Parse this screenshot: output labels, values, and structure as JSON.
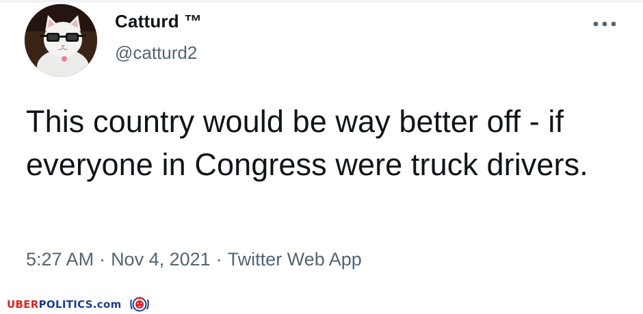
{
  "tweet": {
    "display_name": "Catturd ™",
    "handle": "@catturd2",
    "text": "This country would be way better off - if everyone in Congress were truck drivers.",
    "time": "5:27 AM",
    "date": "Nov 4, 2021",
    "separator": "·",
    "source": "Twitter Web App",
    "more_icon": "more-horizontal-icon",
    "avatar_alt": "white cat wearing black glasses"
  },
  "watermark": {
    "prefix": "UBER",
    "suffix": "POLITICS.com",
    "logo_icon": "lion-crest-icon",
    "colors": {
      "uber": "#d8232a",
      "politics": "#1d3b8c"
    }
  },
  "colors": {
    "text": "#0f1419",
    "secondary": "#536471",
    "background": "#ffffff"
  }
}
